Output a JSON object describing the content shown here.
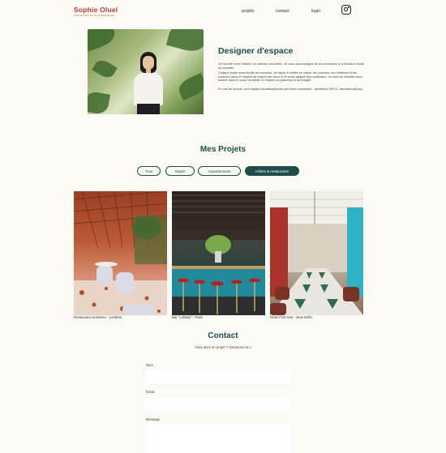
{
  "header": {
    "logo_name": "Sophie Oluel",
    "logo_sub": "ARCHITECTE D'INTERIEUR",
    "nav": {
      "projects": "projets",
      "contact": "contact",
      "login": "login"
    },
    "instagram_icon": "instagram-icon"
  },
  "about": {
    "title": "Designer d'espace",
    "paragraphs": [
      "Je raconte votre histoire, je valorise vos idées. Je vous accompagne de la conception à la livraison finale du chantier.",
      "Chaque projet sera étudié en commun, de façon à mettre en valeur les volumes, les matières et les couleurs dans le respect de l'esprit des lieux et le choix adapté des matériaux. Le suivi du chantier sera assuré dans le souci du détail, le respect du planning et du budget.",
      "En cas de besoin, une équipe pluridisciplinaire peut-être constituée : architecte DPLG, décorateur(trice)"
    ]
  },
  "portfolio": {
    "title": "Mes Projets",
    "filters": [
      "Tous",
      "Objets",
      "Appartements",
      "Hôtels & restaurants"
    ],
    "active_filter": "Hôtels & restaurants",
    "projects": [
      {
        "caption": "Restaurant Sushisen - Londres"
      },
      {
        "caption": "Bar \"Lullaby\" - Paris"
      },
      {
        "caption": "Hotel First Arte - New Delhi"
      }
    ]
  },
  "contact": {
    "title": "Contact",
    "subtitle": "Vous avez un projet ? Discutons-en !",
    "fields": {
      "name_label": "Nom",
      "email_label": "Email",
      "message_label": "Message"
    }
  },
  "colors": {
    "accent": "#1c4f49",
    "brand": "#c0392b",
    "background": "#fbfaf4"
  }
}
